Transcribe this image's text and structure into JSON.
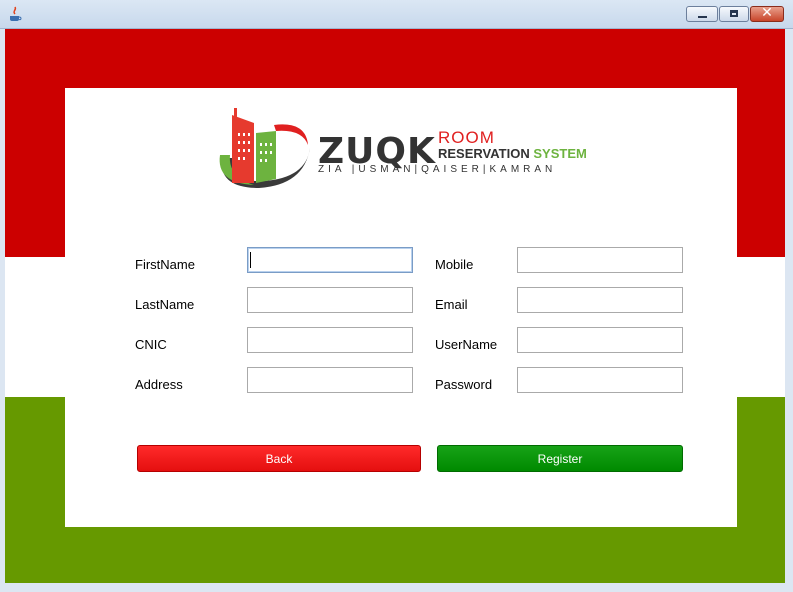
{
  "window": {
    "app_icon": "java-icon"
  },
  "logo": {
    "brand": "ZUQK",
    "room": "ROOM",
    "reservation": "RESERVATION",
    "system": "SYSTEM",
    "names": "ZIA |USMAN|QAISER|KAMRAN"
  },
  "form": {
    "firstname_label": "FirstName",
    "lastname_label": "LastName",
    "cnic_label": "CNIC",
    "address_label": "Address",
    "mobile_label": "Mobile",
    "email_label": "Email",
    "username_label": "UserName",
    "password_label": "Password",
    "firstname_value": "",
    "lastname_value": "",
    "cnic_value": "",
    "address_value": "",
    "mobile_value": "",
    "email_value": "",
    "username_value": "",
    "password_value": ""
  },
  "buttons": {
    "back": "Back",
    "register": "Register"
  },
  "colors": {
    "red_band": "#cc0000",
    "green_band": "#669900",
    "back_button": "#ff1a1a",
    "register_button": "#009900"
  }
}
